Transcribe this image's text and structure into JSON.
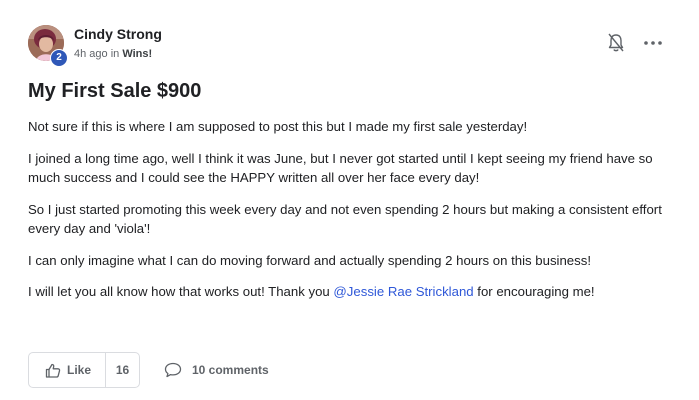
{
  "post": {
    "author": {
      "name": "Cindy Strong",
      "level": "2",
      "time_ago": "4h ago",
      "meta_in": "in",
      "category": "Wins!"
    },
    "title": "My First Sale $900",
    "paragraphs": [
      "Not sure if this is where I am supposed to post this but I made my first sale yesterday!",
      "I joined a long time ago, well I think it was June, but I never got started until I kept seeing my friend have so much success and I could see the HAPPY written all over her face every day!",
      "So I just started promoting this week every day and not even spending 2 hours but making a consistent effort every day and 'viola'!",
      "I can only imagine what I can do moving forward and actually spending 2 hours on this business!"
    ],
    "last_paragraph": {
      "before": "I will let you all know how that works out! Thank you ",
      "mention": "@Jessie Rae Strickland",
      "after": " for encouraging me!"
    },
    "actions": {
      "like_label": "Like",
      "like_count": "16",
      "comments_label": "10 comments"
    },
    "icons": {
      "notification": "bell-icon",
      "more": "more-horizontal-icon",
      "like": "thumbs-up-icon",
      "comment": "comment-bubble-icon"
    },
    "colors": {
      "level_badge": "#2f58b8",
      "mention": "#2f58d8",
      "text": "#202124",
      "muted": "#5f6368"
    }
  }
}
